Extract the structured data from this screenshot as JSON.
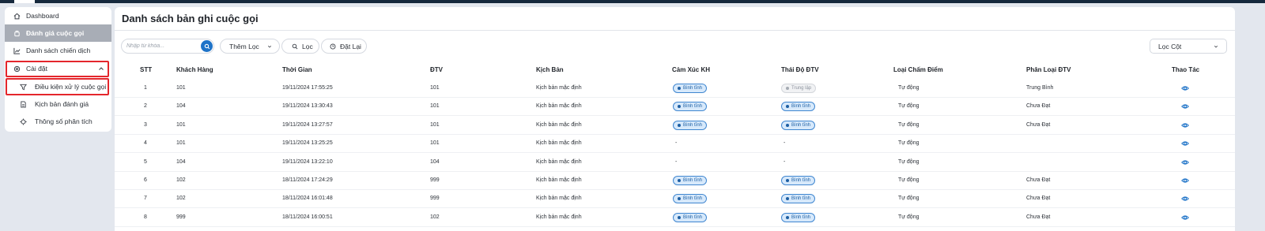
{
  "colors": {
    "accent": "#1e73c8",
    "highlight": "#e4262c",
    "active_nav": "#a8adb6"
  },
  "sidebar": {
    "items": [
      {
        "label": "Dashboard",
        "icon": "home-icon"
      },
      {
        "label": "Đánh giá cuộc gọi",
        "icon": "phone-icon",
        "active": true
      },
      {
        "label": "Danh sách chiến dịch",
        "icon": "chart-icon"
      },
      {
        "label": "Cài đặt",
        "icon": "gear-icon",
        "expanded": true
      },
      {
        "label": "Điều kiện xử lý cuộc gọi",
        "icon": "filter-icon",
        "sub": true
      },
      {
        "label": "Kịch bản đánh giá",
        "icon": "document-icon",
        "sub": true
      },
      {
        "label": "Thông số phân tích",
        "icon": "crosshair-icon",
        "sub": true
      }
    ]
  },
  "main": {
    "title": "Danh sách bản ghi cuộc gọi",
    "search_placeholder": "Nhập từ khóa...",
    "add_filter_label": "Thêm Lọc",
    "filter_label": "Lọc",
    "reset_label": "Đặt Lại",
    "column_filter_label": "Lọc Cột"
  },
  "table": {
    "columns": [
      "STT",
      "Khách Hàng",
      "Thời Gian",
      "ĐTV",
      "Kịch Bản",
      "Cảm Xúc KH",
      "Thái Độ ĐTV",
      "Loại Chấm Điểm",
      "Phân Loại ĐTV",
      "Thao Tác"
    ],
    "rows": [
      {
        "stt": "1",
        "customer": "101",
        "time": "19/11/2024 17:55:25",
        "agent": "101",
        "script": "Kịch bản mặc định",
        "emotion": "Bình tĩnh",
        "emotion_kind": "calm",
        "attitude": "Trung lập",
        "attitude_kind": "neutral",
        "score_type": "Tự động",
        "agent_class": "Trung Bình"
      },
      {
        "stt": "2",
        "customer": "104",
        "time": "19/11/2024 13:30:43",
        "agent": "101",
        "script": "Kịch bản mặc định",
        "emotion": "Bình tĩnh",
        "emotion_kind": "calm",
        "attitude": "Bình tĩnh",
        "attitude_kind": "calm",
        "score_type": "Tự động",
        "agent_class": "Chưa Đạt"
      },
      {
        "stt": "3",
        "customer": "101",
        "time": "19/11/2024 13:27:57",
        "agent": "101",
        "script": "Kịch bản mặc định",
        "emotion": "Bình tĩnh",
        "emotion_kind": "calm",
        "attitude": "Bình tĩnh",
        "attitude_kind": "calm",
        "score_type": "Tự động",
        "agent_class": "Chưa Đạt"
      },
      {
        "stt": "4",
        "customer": "101",
        "time": "19/11/2024 13:25:25",
        "agent": "101",
        "script": "Kịch bản mặc định",
        "emotion": "-",
        "emotion_kind": "none",
        "attitude": "-",
        "attitude_kind": "none",
        "score_type": "Tự động",
        "agent_class": ""
      },
      {
        "stt": "5",
        "customer": "104",
        "time": "19/11/2024 13:22:10",
        "agent": "104",
        "script": "Kịch bản mặc định",
        "emotion": "-",
        "emotion_kind": "none",
        "attitude": "-",
        "attitude_kind": "none",
        "score_type": "Tự động",
        "agent_class": ""
      },
      {
        "stt": "6",
        "customer": "102",
        "time": "18/11/2024 17:24:29",
        "agent": "999",
        "script": "Kịch bản mặc định",
        "emotion": "Bình tĩnh",
        "emotion_kind": "calm",
        "attitude": "Bình tĩnh",
        "attitude_kind": "calm",
        "score_type": "Tự động",
        "agent_class": "Chưa Đạt"
      },
      {
        "stt": "7",
        "customer": "102",
        "time": "18/11/2024 16:01:48",
        "agent": "999",
        "script": "Kịch bản mặc định",
        "emotion": "Bình tĩnh",
        "emotion_kind": "calm",
        "attitude": "Bình tĩnh",
        "attitude_kind": "calm",
        "score_type": "Tự động",
        "agent_class": "Chưa Đạt"
      },
      {
        "stt": "8",
        "customer": "999",
        "time": "18/11/2024 16:00:51",
        "agent": "102",
        "script": "Kịch bản mặc định",
        "emotion": "Bình tĩnh",
        "emotion_kind": "calm",
        "attitude": "Bình tĩnh",
        "attitude_kind": "calm",
        "score_type": "Tự động",
        "agent_class": "Chưa Đạt"
      }
    ]
  }
}
